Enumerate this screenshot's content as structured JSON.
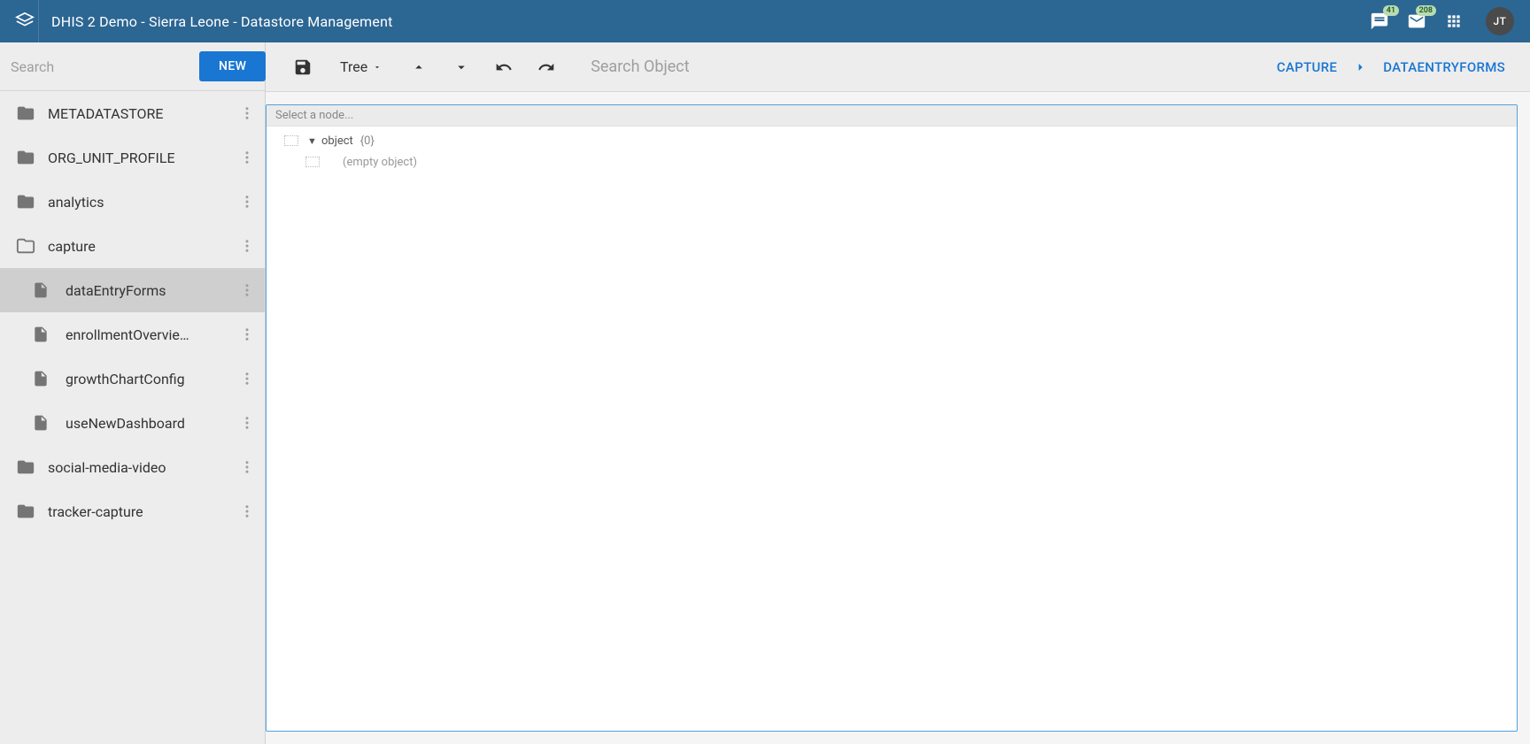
{
  "header": {
    "title": "DHIS 2 Demo - Sierra Leone - Datastore Management",
    "messages_badge": "41",
    "mail_badge": "208",
    "user_initials": "JT"
  },
  "sidebar": {
    "search_placeholder": "Search",
    "new_button": "NEW",
    "items": [
      {
        "label": "METADATASTORE",
        "type": "folder"
      },
      {
        "label": "ORG_UNIT_PROFILE",
        "type": "folder"
      },
      {
        "label": "analytics",
        "type": "folder"
      },
      {
        "label": "capture",
        "type": "folder-open"
      },
      {
        "label": "dataEntryForms",
        "type": "file",
        "level": 1,
        "selected": true
      },
      {
        "label": "enrollmentOvervie…",
        "type": "file",
        "level": 1
      },
      {
        "label": "growthChartConfig",
        "type": "file",
        "level": 1
      },
      {
        "label": "useNewDashboard",
        "type": "file",
        "level": 1
      },
      {
        "label": "social-media-video",
        "type": "folder"
      },
      {
        "label": "tracker-capture",
        "type": "folder"
      }
    ]
  },
  "toolbar": {
    "view_mode": "Tree",
    "search_placeholder": "Search Object",
    "crumb1": "CAPTURE",
    "crumb2": "DATAENTRYFORMS"
  },
  "editor": {
    "path_placeholder": "Select a node...",
    "root_label": "object",
    "root_count": "{0}",
    "empty_label": "(empty object)"
  }
}
